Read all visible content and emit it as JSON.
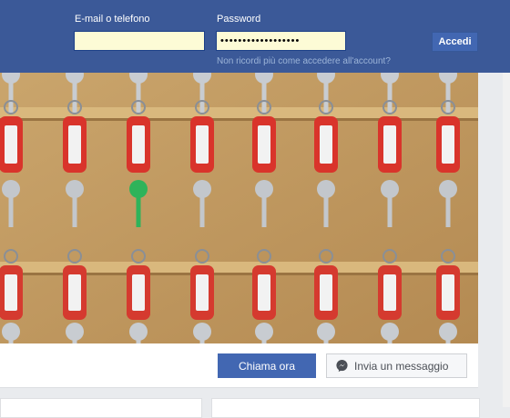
{
  "header": {
    "email_label": "E-mail o telefono",
    "password_label": "Password",
    "email_value": "",
    "password_value": "••••••••••••••••••",
    "login_label": "Accedi",
    "forgot_link": "Non ricordi più come accedere all'account?"
  },
  "actions": {
    "call_label": "Chiama ora",
    "message_label": "Invia un messaggio",
    "message_icon": "messenger-icon"
  },
  "colors": {
    "brand": "#3b5998",
    "button": "#4267b2",
    "autofill": "#fdfbd6"
  },
  "cover_photo": {
    "icon": "keys-photo"
  }
}
